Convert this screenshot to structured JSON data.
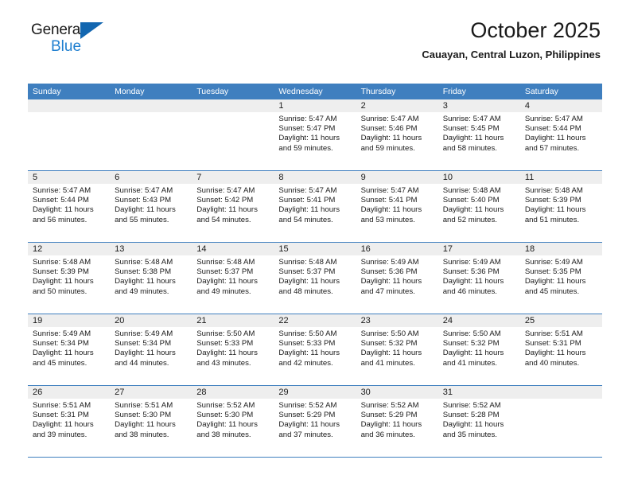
{
  "brand": {
    "name_part1": "General",
    "name_part2": "Blue",
    "triangle_icon": "triangle-icon",
    "accent_color": "#1f7fd0",
    "header_color": "#3f7fbf"
  },
  "header": {
    "title": "October 2025",
    "location": "Cauayan, Central Luzon, Philippines"
  },
  "calendar": {
    "weekday_headers": [
      "Sunday",
      "Monday",
      "Tuesday",
      "Wednesday",
      "Thursday",
      "Friday",
      "Saturday"
    ],
    "weeks": [
      [
        {
          "day": "",
          "sunrise": "",
          "sunset": "",
          "daylight": "",
          "empty": true
        },
        {
          "day": "",
          "sunrise": "",
          "sunset": "",
          "daylight": "",
          "empty": true
        },
        {
          "day": "",
          "sunrise": "",
          "sunset": "",
          "daylight": "",
          "empty": true
        },
        {
          "day": "1",
          "sunrise": "Sunrise: 5:47 AM",
          "sunset": "Sunset: 5:47 PM",
          "daylight": "Daylight: 11 hours and 59 minutes."
        },
        {
          "day": "2",
          "sunrise": "Sunrise: 5:47 AM",
          "sunset": "Sunset: 5:46 PM",
          "daylight": "Daylight: 11 hours and 59 minutes."
        },
        {
          "day": "3",
          "sunrise": "Sunrise: 5:47 AM",
          "sunset": "Sunset: 5:45 PM",
          "daylight": "Daylight: 11 hours and 58 minutes."
        },
        {
          "day": "4",
          "sunrise": "Sunrise: 5:47 AM",
          "sunset": "Sunset: 5:44 PM",
          "daylight": "Daylight: 11 hours and 57 minutes."
        }
      ],
      [
        {
          "day": "5",
          "sunrise": "Sunrise: 5:47 AM",
          "sunset": "Sunset: 5:44 PM",
          "daylight": "Daylight: 11 hours and 56 minutes."
        },
        {
          "day": "6",
          "sunrise": "Sunrise: 5:47 AM",
          "sunset": "Sunset: 5:43 PM",
          "daylight": "Daylight: 11 hours and 55 minutes."
        },
        {
          "day": "7",
          "sunrise": "Sunrise: 5:47 AM",
          "sunset": "Sunset: 5:42 PM",
          "daylight": "Daylight: 11 hours and 54 minutes."
        },
        {
          "day": "8",
          "sunrise": "Sunrise: 5:47 AM",
          "sunset": "Sunset: 5:41 PM",
          "daylight": "Daylight: 11 hours and 54 minutes."
        },
        {
          "day": "9",
          "sunrise": "Sunrise: 5:47 AM",
          "sunset": "Sunset: 5:41 PM",
          "daylight": "Daylight: 11 hours and 53 minutes."
        },
        {
          "day": "10",
          "sunrise": "Sunrise: 5:48 AM",
          "sunset": "Sunset: 5:40 PM",
          "daylight": "Daylight: 11 hours and 52 minutes."
        },
        {
          "day": "11",
          "sunrise": "Sunrise: 5:48 AM",
          "sunset": "Sunset: 5:39 PM",
          "daylight": "Daylight: 11 hours and 51 minutes."
        }
      ],
      [
        {
          "day": "12",
          "sunrise": "Sunrise: 5:48 AM",
          "sunset": "Sunset: 5:39 PM",
          "daylight": "Daylight: 11 hours and 50 minutes."
        },
        {
          "day": "13",
          "sunrise": "Sunrise: 5:48 AM",
          "sunset": "Sunset: 5:38 PM",
          "daylight": "Daylight: 11 hours and 49 minutes."
        },
        {
          "day": "14",
          "sunrise": "Sunrise: 5:48 AM",
          "sunset": "Sunset: 5:37 PM",
          "daylight": "Daylight: 11 hours and 49 minutes."
        },
        {
          "day": "15",
          "sunrise": "Sunrise: 5:48 AM",
          "sunset": "Sunset: 5:37 PM",
          "daylight": "Daylight: 11 hours and 48 minutes."
        },
        {
          "day": "16",
          "sunrise": "Sunrise: 5:49 AM",
          "sunset": "Sunset: 5:36 PM",
          "daylight": "Daylight: 11 hours and 47 minutes."
        },
        {
          "day": "17",
          "sunrise": "Sunrise: 5:49 AM",
          "sunset": "Sunset: 5:36 PM",
          "daylight": "Daylight: 11 hours and 46 minutes."
        },
        {
          "day": "18",
          "sunrise": "Sunrise: 5:49 AM",
          "sunset": "Sunset: 5:35 PM",
          "daylight": "Daylight: 11 hours and 45 minutes."
        }
      ],
      [
        {
          "day": "19",
          "sunrise": "Sunrise: 5:49 AM",
          "sunset": "Sunset: 5:34 PM",
          "daylight": "Daylight: 11 hours and 45 minutes."
        },
        {
          "day": "20",
          "sunrise": "Sunrise: 5:49 AM",
          "sunset": "Sunset: 5:34 PM",
          "daylight": "Daylight: 11 hours and 44 minutes."
        },
        {
          "day": "21",
          "sunrise": "Sunrise: 5:50 AM",
          "sunset": "Sunset: 5:33 PM",
          "daylight": "Daylight: 11 hours and 43 minutes."
        },
        {
          "day": "22",
          "sunrise": "Sunrise: 5:50 AM",
          "sunset": "Sunset: 5:33 PM",
          "daylight": "Daylight: 11 hours and 42 minutes."
        },
        {
          "day": "23",
          "sunrise": "Sunrise: 5:50 AM",
          "sunset": "Sunset: 5:32 PM",
          "daylight": "Daylight: 11 hours and 41 minutes."
        },
        {
          "day": "24",
          "sunrise": "Sunrise: 5:50 AM",
          "sunset": "Sunset: 5:32 PM",
          "daylight": "Daylight: 11 hours and 41 minutes."
        },
        {
          "day": "25",
          "sunrise": "Sunrise: 5:51 AM",
          "sunset": "Sunset: 5:31 PM",
          "daylight": "Daylight: 11 hours and 40 minutes."
        }
      ],
      [
        {
          "day": "26",
          "sunrise": "Sunrise: 5:51 AM",
          "sunset": "Sunset: 5:31 PM",
          "daylight": "Daylight: 11 hours and 39 minutes."
        },
        {
          "day": "27",
          "sunrise": "Sunrise: 5:51 AM",
          "sunset": "Sunset: 5:30 PM",
          "daylight": "Daylight: 11 hours and 38 minutes."
        },
        {
          "day": "28",
          "sunrise": "Sunrise: 5:52 AM",
          "sunset": "Sunset: 5:30 PM",
          "daylight": "Daylight: 11 hours and 38 minutes."
        },
        {
          "day": "29",
          "sunrise": "Sunrise: 5:52 AM",
          "sunset": "Sunset: 5:29 PM",
          "daylight": "Daylight: 11 hours and 37 minutes."
        },
        {
          "day": "30",
          "sunrise": "Sunrise: 5:52 AM",
          "sunset": "Sunset: 5:29 PM",
          "daylight": "Daylight: 11 hours and 36 minutes."
        },
        {
          "day": "31",
          "sunrise": "Sunrise: 5:52 AM",
          "sunset": "Sunset: 5:28 PM",
          "daylight": "Daylight: 11 hours and 35 minutes."
        },
        {
          "day": "",
          "sunrise": "",
          "sunset": "",
          "daylight": "",
          "empty": true
        }
      ]
    ]
  }
}
